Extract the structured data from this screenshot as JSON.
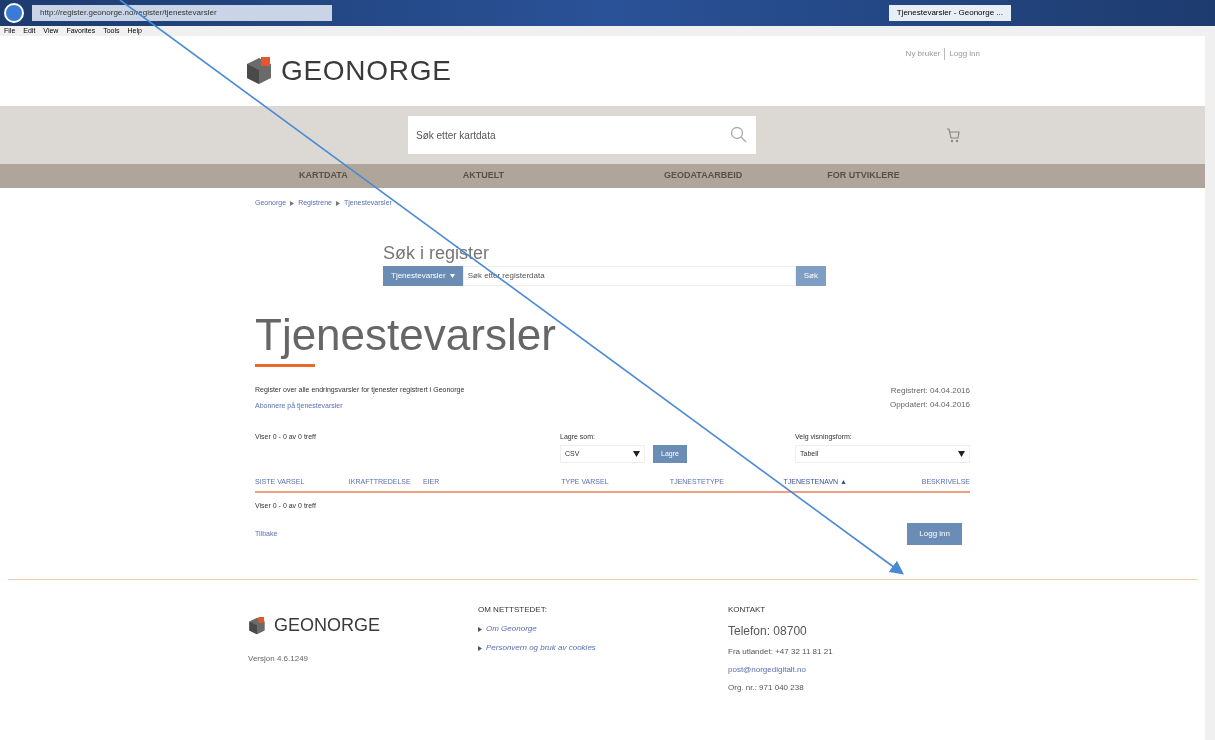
{
  "browser": {
    "address": "http://register.geonorge.no/register/tjenestevarsler",
    "tab_title": "Tjenestevarsler - Geonorge ...",
    "menu": [
      "File",
      "Edit",
      "View",
      "Favorites",
      "Tools",
      "Help"
    ]
  },
  "header": {
    "logo": "GEONORGE",
    "user_links": [
      "Ny bruker",
      "Logg inn"
    ],
    "search_placeholder": "Søk etter kartdata"
  },
  "nav": [
    "KARTDATA",
    "AKTUELT",
    "GEODATAARBEID",
    "FOR UTVIKLERE"
  ],
  "breadcrumb": [
    "Geonorge",
    "Registrene",
    "Tjenestevarsler"
  ],
  "register_search": {
    "title": "Søk i register",
    "dropdown": "Tjenestevarsler",
    "placeholder": "Søk etter registerdata",
    "button": "Søk"
  },
  "page": {
    "title": "Tjenestevarsler",
    "description": "Register over alle endringsvarsler for tjenester registrert i Geonorge",
    "subscribe_link": "Abonnere på tjenestevarsler",
    "registered": "Registrert: 04.04.2016",
    "updated": "Oppdatert: 04.04.2016"
  },
  "results": {
    "count": "Viser 0 - 0 av 0 treff",
    "save_label": "Lagre som:",
    "save_format": "CSV",
    "save_button": "Lagre",
    "view_label": "Velg visningsform:",
    "view_value": "Tabell"
  },
  "table": {
    "columns": [
      {
        "label": "SISTE VARSEL",
        "sorted": false
      },
      {
        "label": "IKRAFTTREDELSE",
        "sorted": false
      },
      {
        "label": "EIER",
        "sorted": false
      },
      {
        "label": "TYPE VARSEL",
        "sorted": false
      },
      {
        "label": "TJENESTETYPE",
        "sorted": false
      },
      {
        "label": "TJENESTENAVN",
        "sorted": true
      },
      {
        "label": "BESKRIVELSE",
        "sorted": false
      }
    ],
    "sort_mark": "▲",
    "count": "Viser 0 - 0 av 0 treff"
  },
  "actions": {
    "back": "Tilbake",
    "login": "Logg inn"
  },
  "footer": {
    "logo": "GEONORGE",
    "version": "Versjon 4.6.1249",
    "about_title": "OM NETTSTEDET:",
    "about_links": [
      "Om Geonorge",
      "Personvern og bruk av cookies"
    ],
    "contact_title": "KONTAKT",
    "phone": "Telefon: 08700",
    "abroad": "Fra utlandet: +47 32 11 81 21",
    "email": "post@norgedigitalt.no",
    "org": "Org. nr.: 971 040 238"
  }
}
